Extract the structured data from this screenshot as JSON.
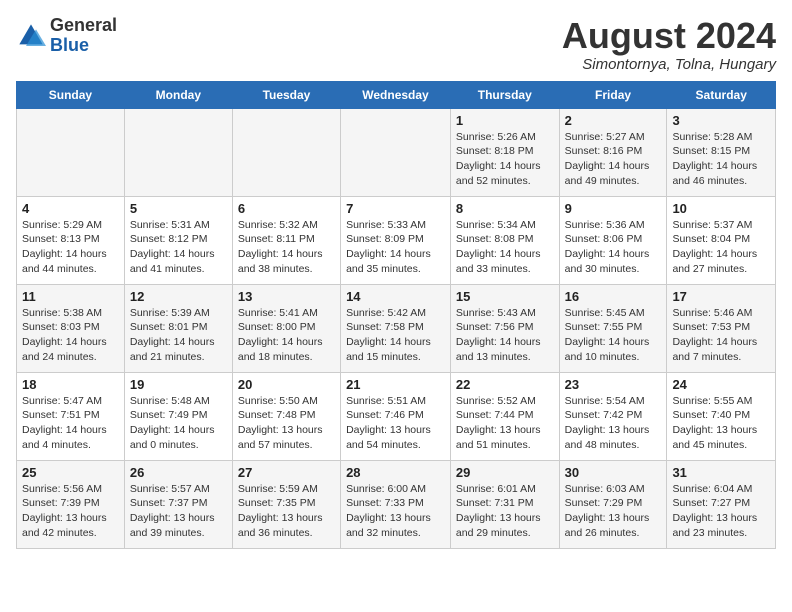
{
  "header": {
    "logo_general": "General",
    "logo_blue": "Blue",
    "month_year": "August 2024",
    "location": "Simontornya, Tolna, Hungary"
  },
  "weekdays": [
    "Sunday",
    "Monday",
    "Tuesday",
    "Wednesday",
    "Thursday",
    "Friday",
    "Saturday"
  ],
  "weeks": [
    [
      {
        "day": "",
        "info": ""
      },
      {
        "day": "",
        "info": ""
      },
      {
        "day": "",
        "info": ""
      },
      {
        "day": "",
        "info": ""
      },
      {
        "day": "1",
        "info": "Sunrise: 5:26 AM\nSunset: 8:18 PM\nDaylight: 14 hours\nand 52 minutes."
      },
      {
        "day": "2",
        "info": "Sunrise: 5:27 AM\nSunset: 8:16 PM\nDaylight: 14 hours\nand 49 minutes."
      },
      {
        "day": "3",
        "info": "Sunrise: 5:28 AM\nSunset: 8:15 PM\nDaylight: 14 hours\nand 46 minutes."
      }
    ],
    [
      {
        "day": "4",
        "info": "Sunrise: 5:29 AM\nSunset: 8:13 PM\nDaylight: 14 hours\nand 44 minutes."
      },
      {
        "day": "5",
        "info": "Sunrise: 5:31 AM\nSunset: 8:12 PM\nDaylight: 14 hours\nand 41 minutes."
      },
      {
        "day": "6",
        "info": "Sunrise: 5:32 AM\nSunset: 8:11 PM\nDaylight: 14 hours\nand 38 minutes."
      },
      {
        "day": "7",
        "info": "Sunrise: 5:33 AM\nSunset: 8:09 PM\nDaylight: 14 hours\nand 35 minutes."
      },
      {
        "day": "8",
        "info": "Sunrise: 5:34 AM\nSunset: 8:08 PM\nDaylight: 14 hours\nand 33 minutes."
      },
      {
        "day": "9",
        "info": "Sunrise: 5:36 AM\nSunset: 8:06 PM\nDaylight: 14 hours\nand 30 minutes."
      },
      {
        "day": "10",
        "info": "Sunrise: 5:37 AM\nSunset: 8:04 PM\nDaylight: 14 hours\nand 27 minutes."
      }
    ],
    [
      {
        "day": "11",
        "info": "Sunrise: 5:38 AM\nSunset: 8:03 PM\nDaylight: 14 hours\nand 24 minutes."
      },
      {
        "day": "12",
        "info": "Sunrise: 5:39 AM\nSunset: 8:01 PM\nDaylight: 14 hours\nand 21 minutes."
      },
      {
        "day": "13",
        "info": "Sunrise: 5:41 AM\nSunset: 8:00 PM\nDaylight: 14 hours\nand 18 minutes."
      },
      {
        "day": "14",
        "info": "Sunrise: 5:42 AM\nSunset: 7:58 PM\nDaylight: 14 hours\nand 15 minutes."
      },
      {
        "day": "15",
        "info": "Sunrise: 5:43 AM\nSunset: 7:56 PM\nDaylight: 14 hours\nand 13 minutes."
      },
      {
        "day": "16",
        "info": "Sunrise: 5:45 AM\nSunset: 7:55 PM\nDaylight: 14 hours\nand 10 minutes."
      },
      {
        "day": "17",
        "info": "Sunrise: 5:46 AM\nSunset: 7:53 PM\nDaylight: 14 hours\nand 7 minutes."
      }
    ],
    [
      {
        "day": "18",
        "info": "Sunrise: 5:47 AM\nSunset: 7:51 PM\nDaylight: 14 hours\nand 4 minutes."
      },
      {
        "day": "19",
        "info": "Sunrise: 5:48 AM\nSunset: 7:49 PM\nDaylight: 14 hours\nand 0 minutes."
      },
      {
        "day": "20",
        "info": "Sunrise: 5:50 AM\nSunset: 7:48 PM\nDaylight: 13 hours\nand 57 minutes."
      },
      {
        "day": "21",
        "info": "Sunrise: 5:51 AM\nSunset: 7:46 PM\nDaylight: 13 hours\nand 54 minutes."
      },
      {
        "day": "22",
        "info": "Sunrise: 5:52 AM\nSunset: 7:44 PM\nDaylight: 13 hours\nand 51 minutes."
      },
      {
        "day": "23",
        "info": "Sunrise: 5:54 AM\nSunset: 7:42 PM\nDaylight: 13 hours\nand 48 minutes."
      },
      {
        "day": "24",
        "info": "Sunrise: 5:55 AM\nSunset: 7:40 PM\nDaylight: 13 hours\nand 45 minutes."
      }
    ],
    [
      {
        "day": "25",
        "info": "Sunrise: 5:56 AM\nSunset: 7:39 PM\nDaylight: 13 hours\nand 42 minutes."
      },
      {
        "day": "26",
        "info": "Sunrise: 5:57 AM\nSunset: 7:37 PM\nDaylight: 13 hours\nand 39 minutes."
      },
      {
        "day": "27",
        "info": "Sunrise: 5:59 AM\nSunset: 7:35 PM\nDaylight: 13 hours\nand 36 minutes."
      },
      {
        "day": "28",
        "info": "Sunrise: 6:00 AM\nSunset: 7:33 PM\nDaylight: 13 hours\nand 32 minutes."
      },
      {
        "day": "29",
        "info": "Sunrise: 6:01 AM\nSunset: 7:31 PM\nDaylight: 13 hours\nand 29 minutes."
      },
      {
        "day": "30",
        "info": "Sunrise: 6:03 AM\nSunset: 7:29 PM\nDaylight: 13 hours\nand 26 minutes."
      },
      {
        "day": "31",
        "info": "Sunrise: 6:04 AM\nSunset: 7:27 PM\nDaylight: 13 hours\nand 23 minutes."
      }
    ]
  ]
}
